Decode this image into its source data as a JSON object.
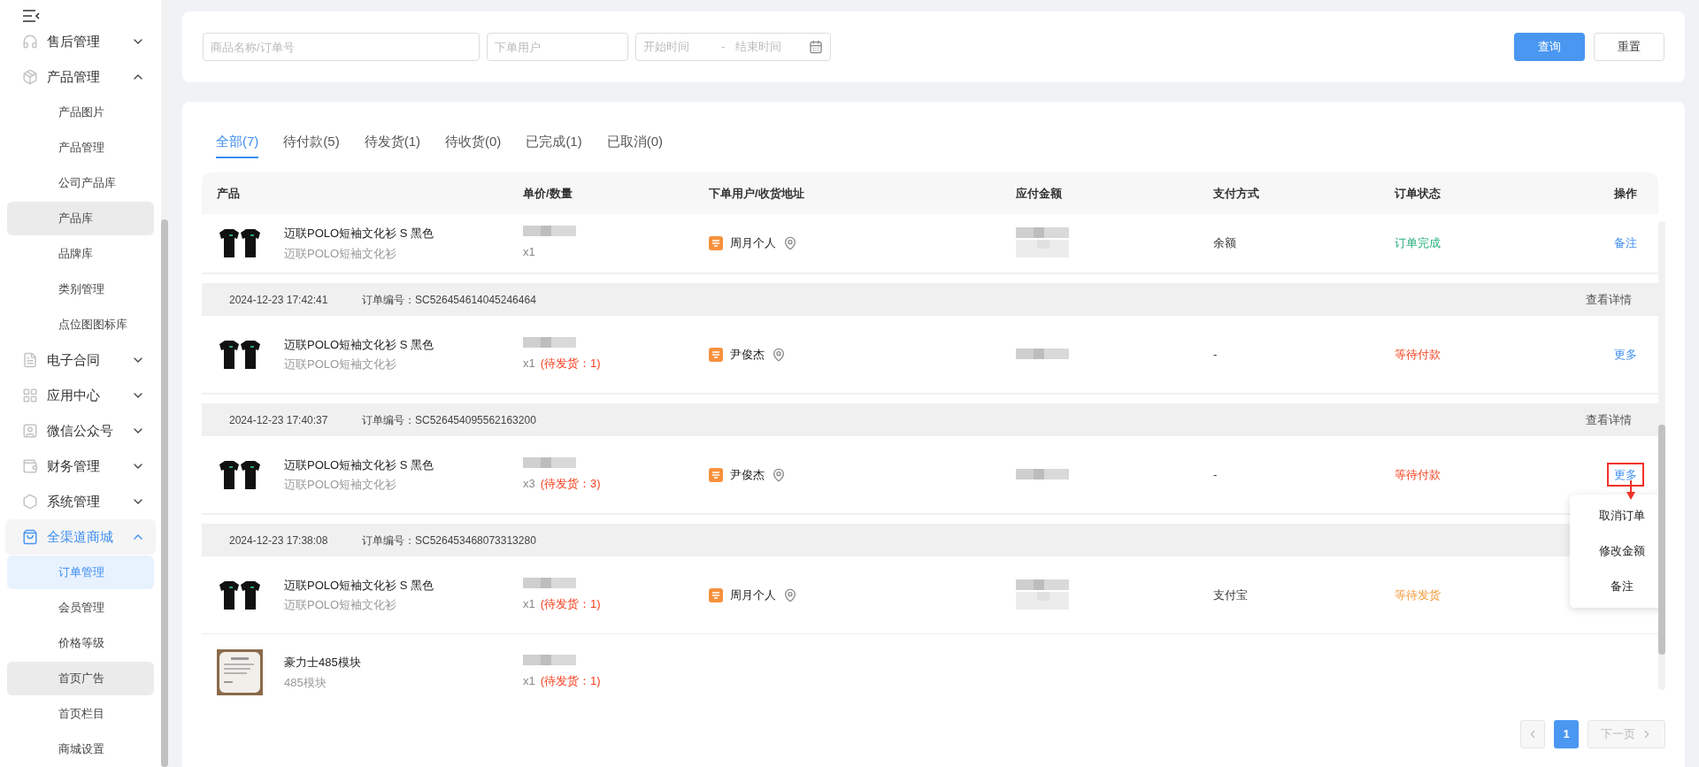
{
  "sidebar": {
    "items": [
      {
        "label": "售后管理",
        "expanded": false,
        "active": false
      },
      {
        "label": "产品管理",
        "expanded": true,
        "active": false,
        "children": [
          {
            "label": "产品图片",
            "selected": false,
            "highlighted": false
          },
          {
            "label": "产品管理",
            "selected": false,
            "highlighted": false
          },
          {
            "label": "公司产品库",
            "selected": false,
            "highlighted": false
          },
          {
            "label": "产品库",
            "selected": false,
            "highlighted": true
          },
          {
            "label": "品牌库",
            "selected": false,
            "highlighted": false
          },
          {
            "label": "类别管理",
            "selected": false,
            "highlighted": false
          },
          {
            "label": "点位图图标库",
            "selected": false,
            "highlighted": false
          }
        ]
      },
      {
        "label": "电子合同",
        "expanded": false,
        "active": false
      },
      {
        "label": "应用中心",
        "expanded": false,
        "active": false
      },
      {
        "label": "微信公众号",
        "expanded": false,
        "active": false
      },
      {
        "label": "财务管理",
        "expanded": false,
        "active": false
      },
      {
        "label": "系统管理",
        "expanded": false,
        "active": false
      },
      {
        "label": "全渠道商城",
        "expanded": true,
        "active": true,
        "children": [
          {
            "label": "订单管理",
            "selected": true
          },
          {
            "label": "会员管理",
            "selected": false,
            "highlighted": false
          },
          {
            "label": "价格等级",
            "selected": false,
            "highlighted": false
          },
          {
            "label": "首页广告",
            "selected": false,
            "highlighted": true
          },
          {
            "label": "首页栏目",
            "selected": false,
            "highlighted": false
          },
          {
            "label": "商城设置",
            "selected": false,
            "highlighted": false
          }
        ]
      }
    ]
  },
  "search": {
    "keyword": {
      "placeholder": "商品名称/订单号"
    },
    "user": {
      "placeholder": "下单用户"
    },
    "date": {
      "start_placeholder": "开始时间",
      "separator": "-",
      "end_placeholder": "结束时间"
    },
    "query_button": "查询",
    "reset_button": "重置"
  },
  "tabs": [
    {
      "label": "全部(7)",
      "selected": true
    },
    {
      "label": "待付款(5)",
      "selected": false
    },
    {
      "label": "待发货(1)",
      "selected": false
    },
    {
      "label": "待收货(0)",
      "selected": false
    },
    {
      "label": "已完成(1)",
      "selected": false
    },
    {
      "label": "已取消(0)",
      "selected": false
    }
  ],
  "table": {
    "columns": [
      "产品",
      "单价/数量",
      "下单用户/收货地址",
      "应付金额",
      "支付方式",
      "订单状态",
      "操作"
    ],
    "orders": [
      {
        "items": [
          {
            "kind": "shirt",
            "name": "迈联POLO短袖文化衫 S 黑色",
            "spec": "迈联POLO短袖文化衫",
            "qty": "x1"
          }
        ],
        "user": "周月个人",
        "pay": "余额",
        "status": {
          "text": "订单完成",
          "kind": "done"
        },
        "actions": [
          {
            "label": "备注",
            "highlighted": false
          }
        ]
      },
      {
        "time": "2024-12-23 17:42:41",
        "order_no": "订单编号：SC526454614045246464",
        "detail": "查看详情",
        "items": [
          {
            "kind": "shirt",
            "name": "迈联POLO短袖文化衫 S 黑色",
            "spec": "迈联POLO短袖文化衫",
            "qty": "x1",
            "pending": "(待发货：1)"
          }
        ],
        "user": "尹俊杰",
        "pay": "-",
        "status": {
          "text": "等待付款",
          "kind": "unpaid"
        },
        "actions": [
          {
            "label": "更多",
            "highlighted": false
          }
        ]
      },
      {
        "time": "2024-12-23 17:40:37",
        "order_no": "订单编号：SC526454095562163200",
        "detail": "查看详情",
        "items": [
          {
            "kind": "shirt",
            "name": "迈联POLO短袖文化衫 S 黑色",
            "spec": "迈联POLO短袖文化衫",
            "qty": "x3",
            "pending": "(待发货：3)"
          }
        ],
        "user": "尹俊杰",
        "pay": "-",
        "status": {
          "text": "等待付款",
          "kind": "unpaid"
        },
        "actions": [
          {
            "label": "更多",
            "highlighted": true
          }
        ],
        "dropdown": [
          "取消订单",
          "修改金额",
          "备注"
        ]
      },
      {
        "time": "2024-12-23 17:38:08",
        "order_no": "订单编号：SC526453468073313280",
        "items": [
          {
            "kind": "shirt",
            "name": "迈联POLO短袖文化衫 S 黑色",
            "spec": "迈联POLO短袖文化衫",
            "qty": "x1",
            "pending": "(待发货：1)"
          },
          {
            "kind": "module",
            "name": "豪力士485模块",
            "spec": "485模块",
            "qty": "x1",
            "pending": "(待发货：1)"
          }
        ],
        "user": "周月个人",
        "pay": "支付宝",
        "status": {
          "text": "等待发货",
          "kind": "unshipped"
        }
      }
    ]
  },
  "pagination": {
    "prev_disabled": true,
    "pages": [
      {
        "label": "1",
        "selected": true
      }
    ],
    "next": {
      "label": "下一页",
      "disabled": true
    }
  }
}
